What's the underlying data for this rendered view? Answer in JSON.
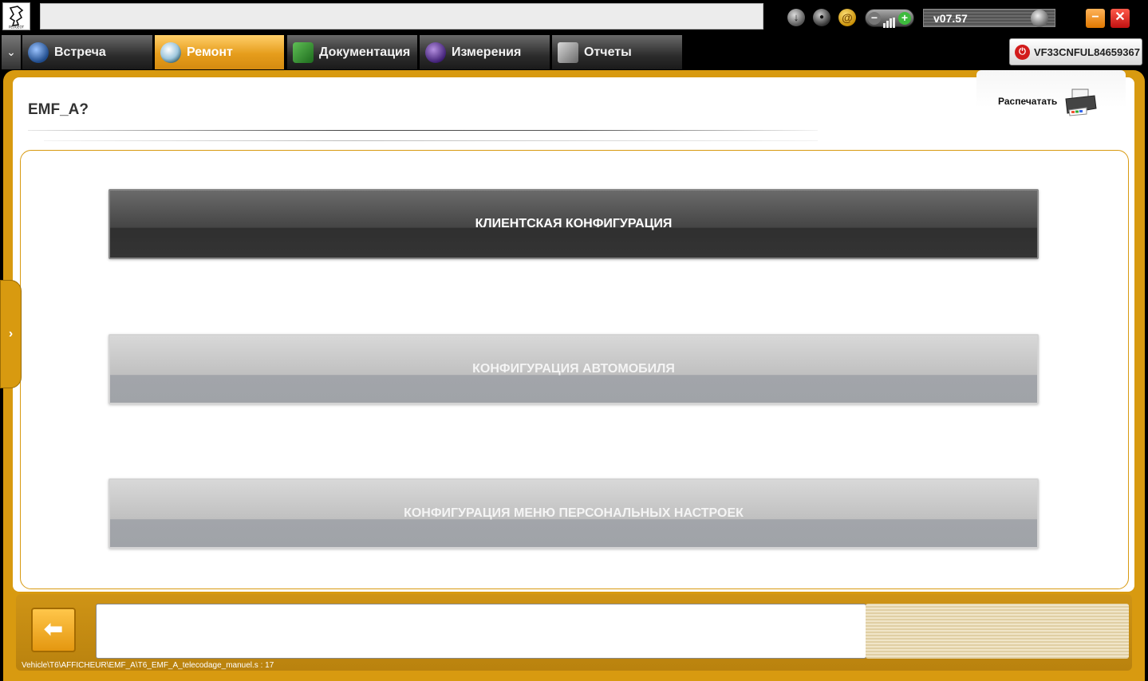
{
  "topbar": {
    "logo_text": "PEUGEOT",
    "version": "v07.57"
  },
  "tabs": [
    {
      "label": "Встреча",
      "icon": "meeting-icon",
      "active": false
    },
    {
      "label": "Ремонт",
      "icon": "magnifier-icon",
      "active": true
    },
    {
      "label": "Документация",
      "icon": "book-icon",
      "active": false
    },
    {
      "label": "Измерения",
      "icon": "waveform-icon",
      "active": false
    },
    {
      "label": "Отчеты",
      "icon": "report-icon",
      "active": false
    }
  ],
  "vin": "VF33CNFUL84659367",
  "page": {
    "title": "EMF_A?",
    "print_label": "Распечатать"
  },
  "menu": {
    "items": [
      {
        "label": "КЛИЕНТСКАЯ КОНФИГУРАЦИЯ",
        "state": "selected"
      },
      {
        "label": "КОНФИГУРАЦИЯ АВТОМОБИЛЯ",
        "state": "normal"
      },
      {
        "label": "КОНФИГУРАЦИЯ МЕНЮ ПЕРСОНАЛЬНЫХ НАСТРОЕК",
        "state": "normal"
      }
    ]
  },
  "footer": {
    "message": "",
    "path": "Vehicle\\T6\\AFFICHEUR\\EMF_A\\T6_EMF_A_telecodage_manuel.s : 17"
  },
  "colors": {
    "accent": "#d89a10",
    "tab_active": "#e69d1c",
    "button_dark": "#3a3a3a",
    "button_grey": "#b5b7bb"
  }
}
